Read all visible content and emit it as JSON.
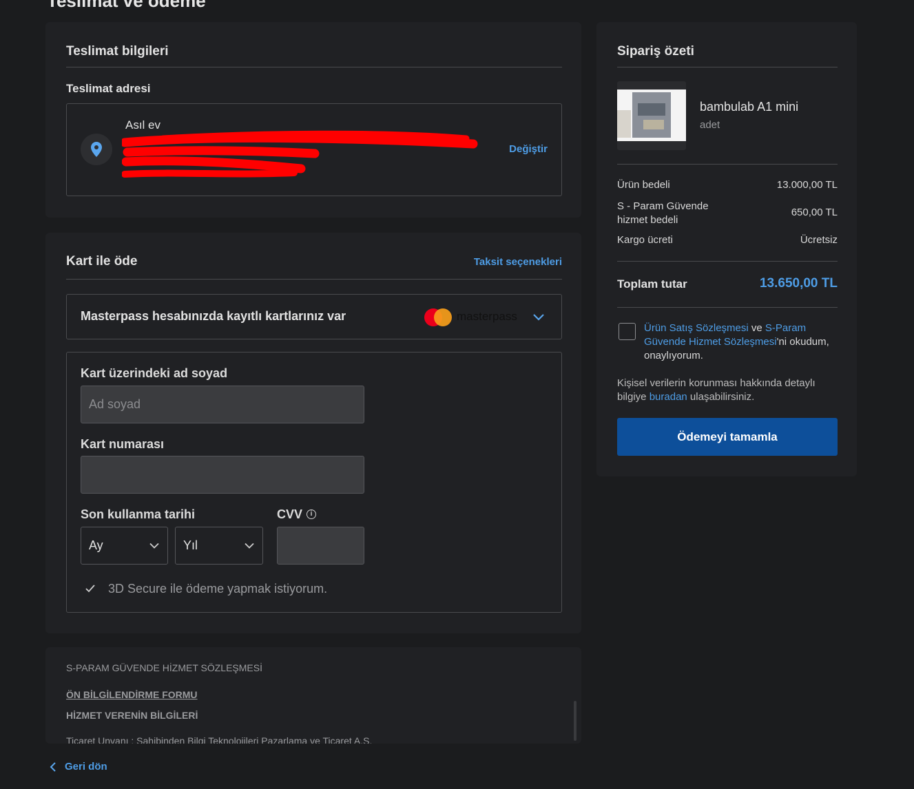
{
  "page": {
    "title": "Teslimat ve ödeme"
  },
  "delivery": {
    "title": "Teslimat bilgileri",
    "address_label": "Teslimat adresi",
    "address_name": "Asıl ev",
    "change_link": "Değiştir",
    "redaction_color": "#ff0000"
  },
  "payment": {
    "title": "Kart ile öde",
    "installments_link": "Taksit seçenekleri",
    "masterpass_text": "Masterpass hesabınızda kayıtlı kartlarınız var",
    "masterpass_brand": "masterpass",
    "card_name_label": "Kart üzerindeki ad soyad",
    "card_name_placeholder": "Ad soyad",
    "card_number_label": "Kart numarası",
    "expiry_label": "Son kullanma tarihi",
    "month_value": "Ay",
    "year_value": "Yıl",
    "cvv_label": "CVV",
    "secure_3d_label": "3D Secure ile ödeme yapmak istiyorum."
  },
  "agreement": {
    "heading": "S-PARAM GÜVENDE HİZMET SÖZLEŞMESİ",
    "link_form": "ÖN BİLGİLENDİRME FORMU",
    "service_info": "HİZMET VERENİN BİLGİLERİ",
    "cutoff_line": "Ticaret Unvanı : Sahibinden Bilgi Teknolojileri Pazarlama ve Ticaret A.Ş."
  },
  "back_link": "Geri dön",
  "summary": {
    "title": "Sipariş özeti",
    "product_name": "bambulab A1 mini",
    "product_unit": "adet",
    "rows": [
      {
        "label": "Ürün bedeli",
        "value": "13.000,00 TL"
      },
      {
        "label": "S - Param Güvende hizmet bedeli",
        "value": "650,00 TL"
      },
      {
        "label": "Kargo ücreti",
        "value": "Ücretsiz"
      }
    ],
    "total_label": "Toplam tutar",
    "total_value": "13.650,00 TL",
    "terms_link1": "Ürün Satış Sözleşmesi",
    "terms_and": " ve ",
    "terms_link2": "S-Param Güvende Hizmet Sözleşmesi",
    "terms_suffix": "'ni okudum, onaylıyorum.",
    "privacy_text": "Kişisel verilerin korunması hakkında detaylı bilgiye ",
    "privacy_link": "buradan",
    "privacy_suffix": " ulaşabilirsiniz.",
    "complete_button": "Ödemeyi tamamla",
    "accent_color": "#4e9de6",
    "button_color": "#0d4f9a"
  }
}
